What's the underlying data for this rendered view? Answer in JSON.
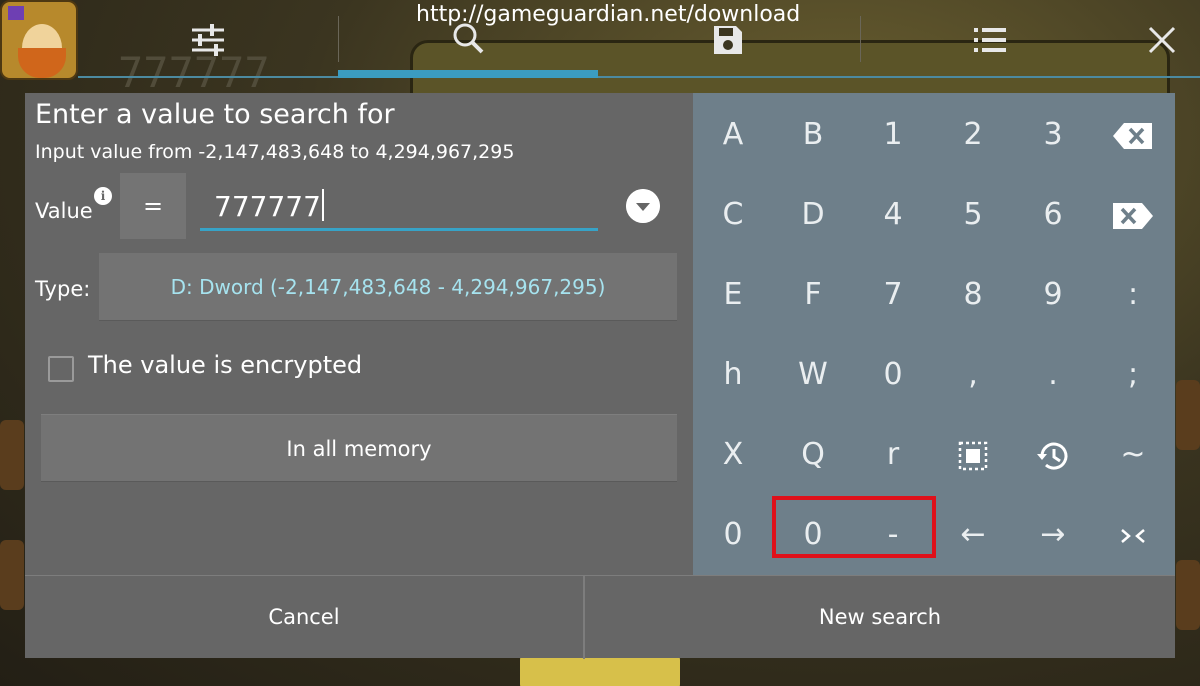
{
  "topbar": {
    "url": "http://gameguardian.net/download",
    "icons": [
      "sliders-icon",
      "search-icon",
      "save-icon",
      "list-icon",
      "close-icon"
    ]
  },
  "dialog": {
    "title": "Enter a value to search for",
    "subtitle": "Input value from -2,147,483,648 to 4,294,967,295",
    "value_label": "Value",
    "info_glyph": "i",
    "operator": "=",
    "value": "777777",
    "type_label": "Type:",
    "type_value": "D: Dword (-2,147,483,648 - 4,294,967,295)",
    "encrypted_label": "The value is encrypted",
    "encrypted_checked": false,
    "memory_range": "In all memory"
  },
  "keypad": {
    "rows": [
      [
        "A",
        "B",
        "1",
        "2",
        "3",
        "backspace-icon"
      ],
      [
        "C",
        "D",
        "4",
        "5",
        "6",
        "clear-icon"
      ],
      [
        "E",
        "F",
        "7",
        "8",
        "9",
        ":"
      ],
      [
        "h",
        "W",
        "0",
        ",",
        ".",
        ";"
      ],
      [
        "X",
        "Q",
        "r",
        "select-all-icon",
        "history-icon",
        "~"
      ],
      [
        "0",
        "0",
        "-",
        "←",
        "→",
        "collapse-icon"
      ]
    ]
  },
  "buttons": {
    "cancel": "Cancel",
    "new_search": "New search"
  },
  "colors": {
    "dialog_bg": "#666666",
    "keypad_bg": "#6e7f8a",
    "accent": "#37a3c7",
    "type_text": "#a6e3ef",
    "highlight": "#e0101a"
  }
}
